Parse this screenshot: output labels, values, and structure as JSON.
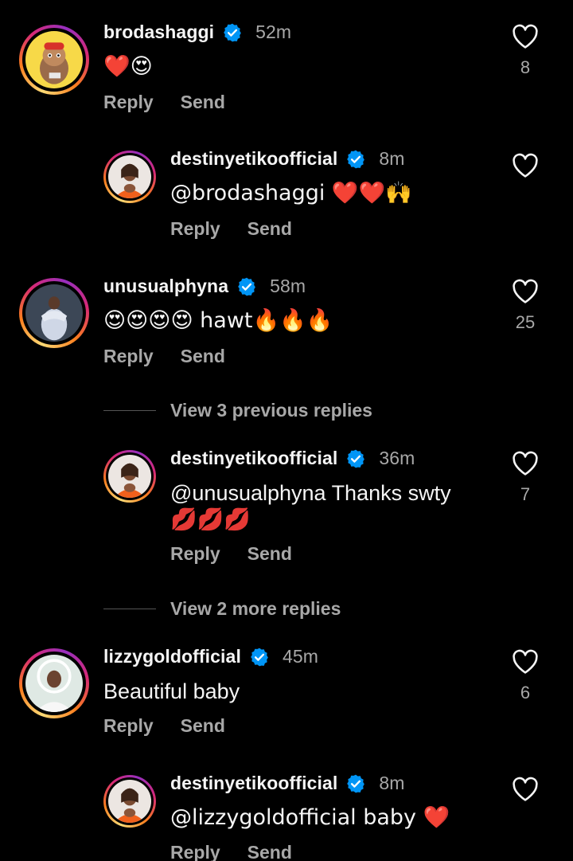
{
  "comments": [
    {
      "username": "brodashaggi",
      "time": "52m",
      "text": "❤️😍",
      "likes": "8",
      "reply": "Reply",
      "send": "Send"
    },
    {
      "username": "destinyetikoofficial",
      "time": "8m",
      "text": "@brodashaggi ❤️❤️🙌",
      "likes": "",
      "reply": "Reply",
      "send": "Send"
    },
    {
      "username": "unusualphyna",
      "time": "58m",
      "text": "😍😍😍😍 hawt🔥🔥🔥",
      "likes": "25",
      "reply": "Reply",
      "send": "Send"
    },
    {
      "username": "destinyetikoofficial",
      "time": "36m",
      "text_line1": "@unusualphyna Thanks swty",
      "text_line2": "💋💋💋",
      "likes": "7",
      "reply": "Reply",
      "send": "Send"
    },
    {
      "username": "lizzygoldofficial",
      "time": "45m",
      "text": "Beautiful baby",
      "likes": "6",
      "reply": "Reply",
      "send": "Send"
    },
    {
      "username": "destinyetikoofficial",
      "time": "8m",
      "text": "@lizzygoldofficial baby ❤️",
      "likes": "",
      "reply": "Reply",
      "send": "Send"
    }
  ],
  "view_replies": [
    {
      "label": "View 3 previous replies"
    },
    {
      "label": "View 2 more replies"
    }
  ],
  "icons": {
    "verified": "verified-badge-icon",
    "like": "heart-outline-icon"
  },
  "colors": {
    "background": "#000000",
    "text": "#f5f5f5",
    "muted": "#a8a8a8",
    "verified": "#0095f6"
  }
}
